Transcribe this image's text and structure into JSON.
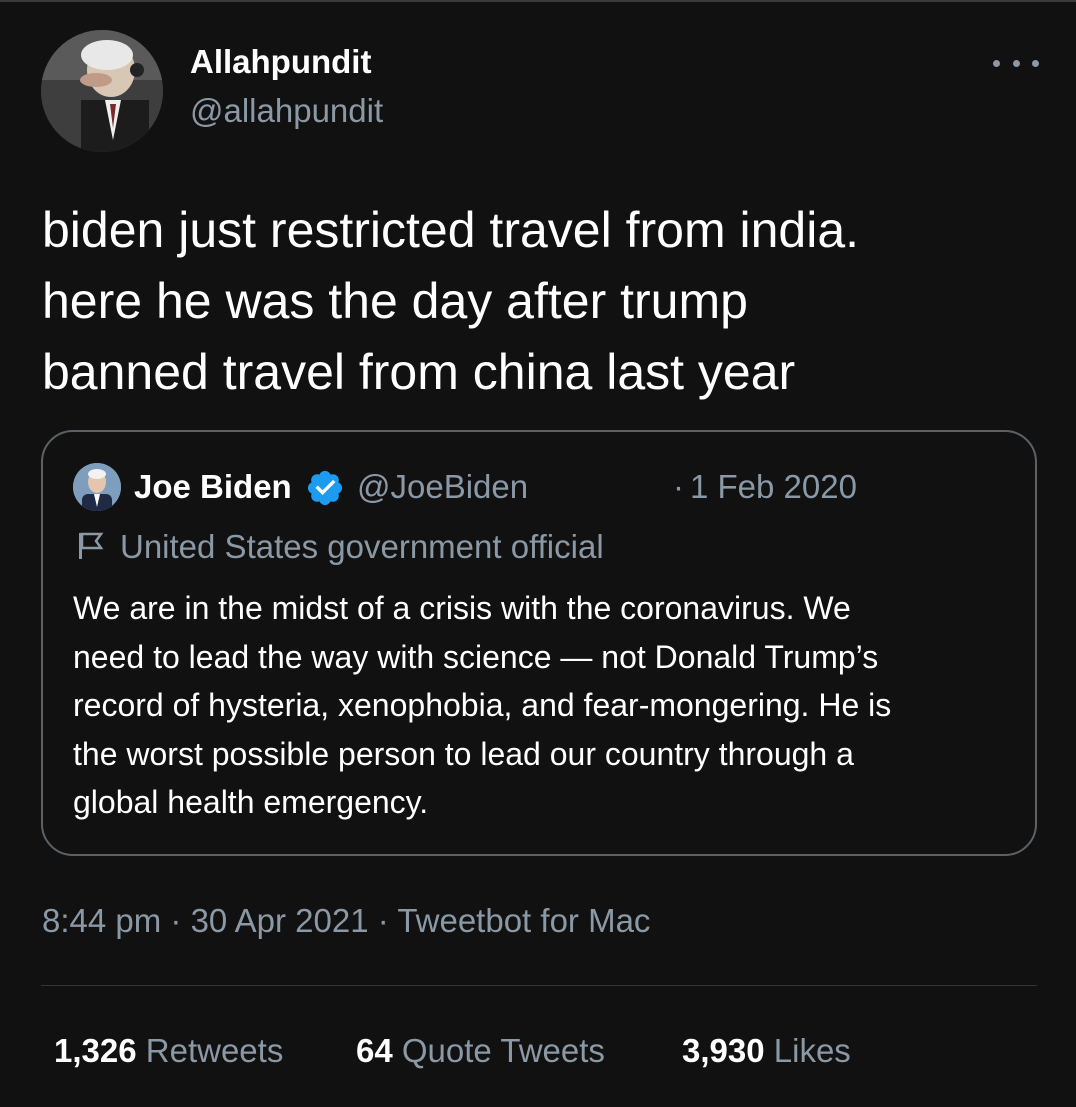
{
  "author": {
    "display_name": "Allahpundit",
    "handle": "@allahpundit"
  },
  "tweet": {
    "text_lines": [
      "biden just restricted travel from india.",
      "here he was the day after trump",
      "banned travel from china last year"
    ]
  },
  "quoted_tweet": {
    "display_name": "Joe Biden",
    "handle": "@JoeBiden",
    "separator": "·",
    "date": "1 Feb 2020",
    "label": "United States government official",
    "text_lines": [
      "We are in the midst of a crisis with the coronavirus. We",
      "need to lead the way with science — not Donald Trump’s",
      "record of hysteria, xenophobia, and fear-mongering. He is",
      "the worst possible person to lead our country through a",
      "global health emergency."
    ]
  },
  "meta": {
    "time": "8:44 pm",
    "sep1": " · ",
    "date": "30 Apr 2021",
    "sep2": " · ",
    "source": "Tweetbot for Mac"
  },
  "stats": {
    "retweets": {
      "count": "1,326",
      "label": "Retweets"
    },
    "quotes": {
      "count": "64",
      "label": "Quote Tweets"
    },
    "likes": {
      "count": "3,930",
      "label": "Likes"
    }
  },
  "colors": {
    "background": "#111111",
    "secondary_text": "#8b98a5",
    "verified": "#1d9bf0"
  },
  "icons": [
    "more-icon",
    "verified-badge-icon",
    "flag-icon"
  ]
}
